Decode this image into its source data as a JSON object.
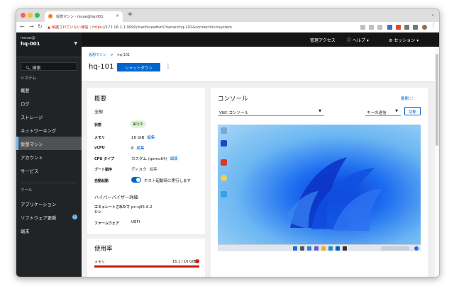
{
  "browser": {
    "tab_title": "仮想マシン - inoue@hq-001",
    "tab_close": "×",
    "new_tab": "+",
    "url_warning": "保護されていない通信",
    "url_https": "https",
    "url_rest": "://172.16.1.1:9090/machines#vm?name=hq-101&connection=system"
  },
  "sidebar": {
    "user": "inoue@",
    "host": "hq-001",
    "search": "検索",
    "group_system": "システム",
    "items": [
      {
        "label": "概要"
      },
      {
        "label": "ログ"
      },
      {
        "label": "ストレージ"
      },
      {
        "label": "ネットワーキング"
      },
      {
        "label": "仮想マシン"
      },
      {
        "label": "アカウント"
      },
      {
        "label": "サービス"
      }
    ],
    "group_tools": "ツール",
    "tools": [
      {
        "label": "アプリケーション"
      },
      {
        "label": "ソフトウェア更新",
        "badge": "!"
      },
      {
        "label": "端末"
      }
    ]
  },
  "masthead": {
    "admin": "管理アクセス",
    "help": "ヘルプ",
    "session": "セッション"
  },
  "page": {
    "breadcrumb_root": "仮想マシン",
    "breadcrumb_sep": ">",
    "breadcrumb_current": "hq-101",
    "title": "hq-101",
    "shutdown": "シャットダウン",
    "kebab": "⋮"
  },
  "overview": {
    "title": "概要",
    "general": "全般",
    "rows": {
      "state_label": "状態",
      "state_value": "実行中",
      "memory_label": "メモリ",
      "memory_value": "16 GiB",
      "vcpu_label": "vCPU",
      "vcpu_value": "8",
      "cputype_label": "CPU タイプ",
      "cputype_value": "カスタム (qemu64)",
      "boot_label": "ブート順序",
      "boot_value": "ディスク",
      "autostart_label": "自動起動",
      "autostart_value": "ホスト起動時に実行します"
    },
    "edit": "編集",
    "hypervisor": "ハイパーバイザー詳細",
    "emulated_label": "エミュレートされたマシン",
    "emulated_value": "pc-q35-6.2",
    "firmware_label": "ファームウェア",
    "firmware_value": "UEFI"
  },
  "usage": {
    "title": "使用率",
    "memory_label": "メモリ",
    "memory_value": "16.1 / 16 GiB",
    "memory_fraction": 1.0
  },
  "console": {
    "title": "コンソール",
    "expand": "展開",
    "type": "VNC コンソール",
    "send_key": "キーの送信",
    "disconnect": "切断"
  },
  "colors": {
    "accent": "#0066cc",
    "danger": "#c9190b",
    "sidebar": "#212427"
  }
}
